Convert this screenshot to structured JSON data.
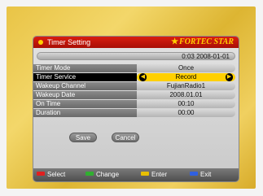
{
  "header": {
    "title": "Timer Setting",
    "brand": "FORTEC STAR",
    "brand_icon": "star-icon"
  },
  "datetime": "0:03 2008-01-01",
  "rows": [
    {
      "label": "Timer Mode",
      "value": "Once"
    },
    {
      "label": "Timer Service",
      "value": "Record"
    },
    {
      "label": "Wakeup Channel",
      "value": "FujianRadio1"
    },
    {
      "label": "Wakeup Date",
      "value": "2008.01.01"
    },
    {
      "label": "On Time",
      "value": "00:10"
    },
    {
      "label": "Duration",
      "value": "00:00"
    }
  ],
  "buttons": {
    "save": "Save",
    "cancel": "Cancel"
  },
  "hints": [
    {
      "key": "red",
      "label": "Select"
    },
    {
      "key": "green",
      "label": "Change"
    },
    {
      "key": "yellow",
      "label": "Enter"
    },
    {
      "key": "blue",
      "label": "Exit"
    }
  ],
  "colors": {
    "header": "#c8160b",
    "highlight": "#ffd000",
    "background": "#e9c446"
  }
}
